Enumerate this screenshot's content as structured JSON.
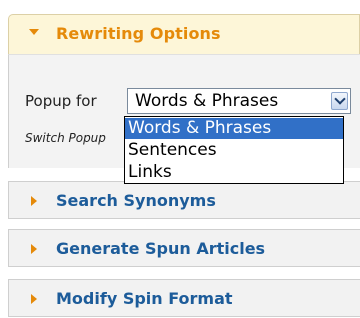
{
  "accordion": {
    "rewriting_options": {
      "title": "Rewriting Options",
      "expanded": true
    },
    "search_synonyms": {
      "title": "Search Synonyms"
    },
    "generate_spun_articles": {
      "title": "Generate Spun Articles"
    },
    "modify_spin_format": {
      "title": "Modify Spin Format"
    }
  },
  "rewriting_panel": {
    "popup_label": "Popup for",
    "popup_select": {
      "selected": "Words & Phrases",
      "options": [
        "Words & Phrases",
        "Sentences",
        "Links"
      ],
      "highlighted_index": 0
    },
    "switch_text": "Switch Popup"
  },
  "colors": {
    "accent_orange": "#e58a0a",
    "link_blue": "#1d5c9a",
    "selection_blue": "#3170c7"
  }
}
